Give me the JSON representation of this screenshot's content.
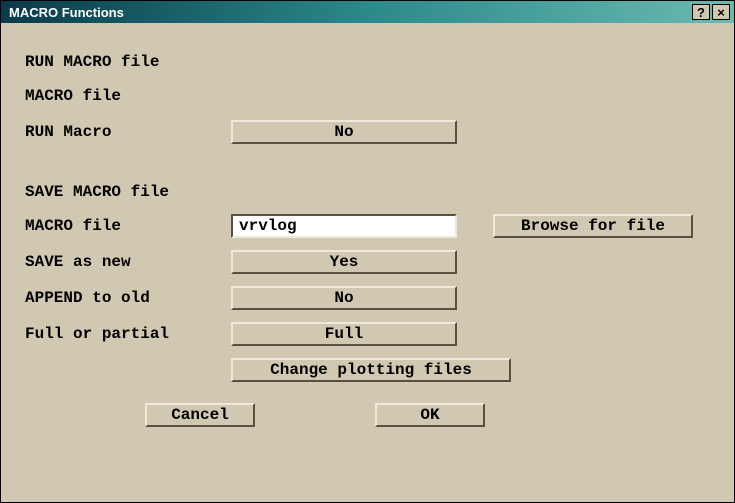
{
  "window": {
    "title": "MACRO Functions",
    "help_icon": "?",
    "close_icon": "×"
  },
  "run_section": {
    "heading": "RUN MACRO file",
    "file_label": "MACRO file",
    "run_label": "RUN Macro",
    "run_value": "No"
  },
  "save_section": {
    "heading": "SAVE MACRO file",
    "file_label": "MACRO file",
    "file_value": "vrvlog",
    "browse_label": "Browse for file",
    "save_new_label": "SAVE as new",
    "save_new_value": "Yes",
    "append_label": "APPEND to old",
    "append_value": "No",
    "full_label": "Full or partial",
    "full_value": "Full",
    "change_plot_label": "Change plotting files"
  },
  "footer": {
    "cancel": "Cancel",
    "ok": "OK"
  }
}
